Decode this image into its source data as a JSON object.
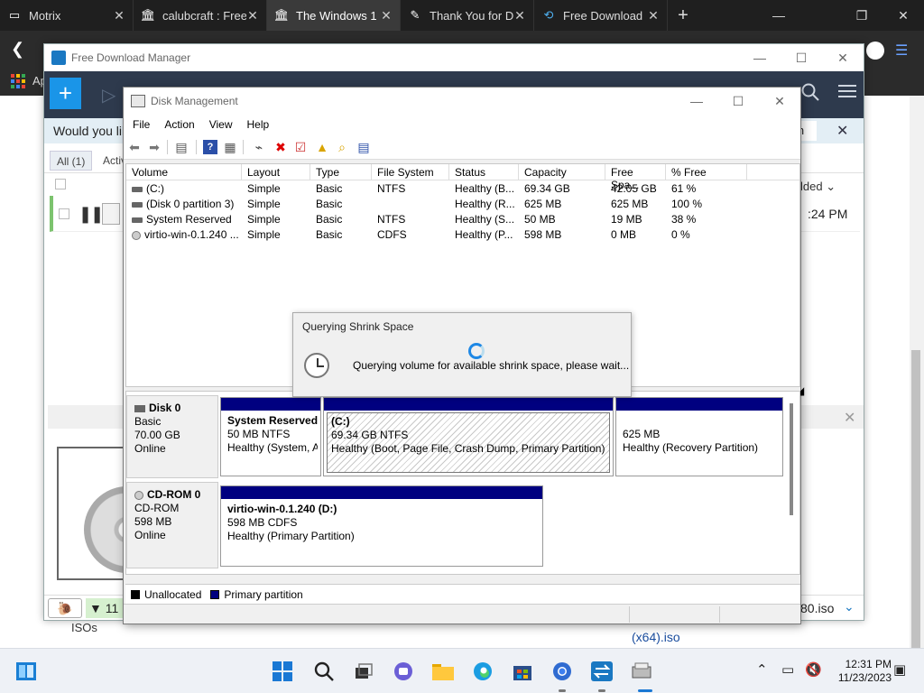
{
  "browser": {
    "tabs": [
      {
        "title": "Motrix",
        "active": false
      },
      {
        "title": "calubcraft : Free",
        "active": false
      },
      {
        "title": "The Windows 1",
        "active": true
      },
      {
        "title": "Thank You for D",
        "active": false
      },
      {
        "title": "Free Download",
        "active": false
      }
    ],
    "apps_label": "Ap",
    "window_controls": {
      "minimize": "—",
      "maximize": "❐",
      "close": "✕"
    },
    "icons": [
      "back-icon",
      "apps-grid-icon",
      "profile-icon",
      "menu-icon",
      "new-tab-icon"
    ]
  },
  "page": {
    "isos_label": "ISOs",
    "iso_link_text": "(x64).iso"
  },
  "fdm": {
    "title": "Free Download Manager",
    "add_label": "+",
    "banner_text": "Would you lik",
    "banner_btn": "in",
    "filters": [
      "All (1)",
      "Activ"
    ],
    "sort_label": "lded ⌄",
    "row_time": ":24 PM",
    "speed_text": "▼ 11 M",
    "status_file": "80.iso",
    "accent": "#1a95e8"
  },
  "dm": {
    "title": "Disk Management",
    "menu": [
      "File",
      "Action",
      "View",
      "Help"
    ],
    "columns": [
      "Volume",
      "Layout",
      "Type",
      "File System",
      "Status",
      "Capacity",
      "Free Spa...",
      "% Free"
    ],
    "volumes": [
      {
        "volume": "(C:)",
        "layout": "Simple",
        "type": "Basic",
        "fs": "NTFS",
        "status": "Healthy (B...",
        "capacity": "69.34 GB",
        "free": "42.05 GB",
        "pct": "61 %"
      },
      {
        "volume": "(Disk 0 partition 3)",
        "layout": "Simple",
        "type": "Basic",
        "fs": "",
        "status": "Healthy (R...",
        "capacity": "625 MB",
        "free": "625 MB",
        "pct": "100 %"
      },
      {
        "volume": "System Reserved",
        "layout": "Simple",
        "type": "Basic",
        "fs": "NTFS",
        "status": "Healthy (S...",
        "capacity": "50 MB",
        "free": "19 MB",
        "pct": "38 %"
      },
      {
        "volume": "virtio-win-0.1.240 ...",
        "layout": "Simple",
        "type": "Basic",
        "fs": "CDFS",
        "status": "Healthy (P...",
        "capacity": "598 MB",
        "free": "0 MB",
        "pct": "0 %"
      }
    ],
    "disks": [
      {
        "name": "Disk 0",
        "kind": "Basic",
        "size": "70.00 GB",
        "state": "Online",
        "partitions": [
          {
            "name": "System Reserved",
            "size": "50 MB NTFS",
            "status": "Healthy (System, A"
          },
          {
            "name": "(C:)",
            "size": "69.34 GB NTFS",
            "status": "Healthy (Boot, Page File, Crash Dump, Primary Partition)"
          },
          {
            "name": "",
            "size": "625 MB",
            "status": "Healthy (Recovery Partition)"
          }
        ]
      },
      {
        "name": "CD-ROM 0",
        "kind": "CD-ROM",
        "size": "598 MB",
        "state": "Online",
        "partitions": [
          {
            "name": "virtio-win-0.1.240  (D:)",
            "size": "598 MB CDFS",
            "status": "Healthy (Primary Partition)"
          }
        ]
      }
    ],
    "legend": [
      {
        "label": "Unallocated",
        "color": "#000000"
      },
      {
        "label": "Primary partition",
        "color": "#000080"
      }
    ],
    "primary_color": "#000080"
  },
  "dialog": {
    "title": "Querying Shrink Space",
    "message": "Querying volume for available shrink space, please wait..."
  },
  "taskbar": {
    "time": "12:31 PM",
    "date": "11/23/2023"
  }
}
